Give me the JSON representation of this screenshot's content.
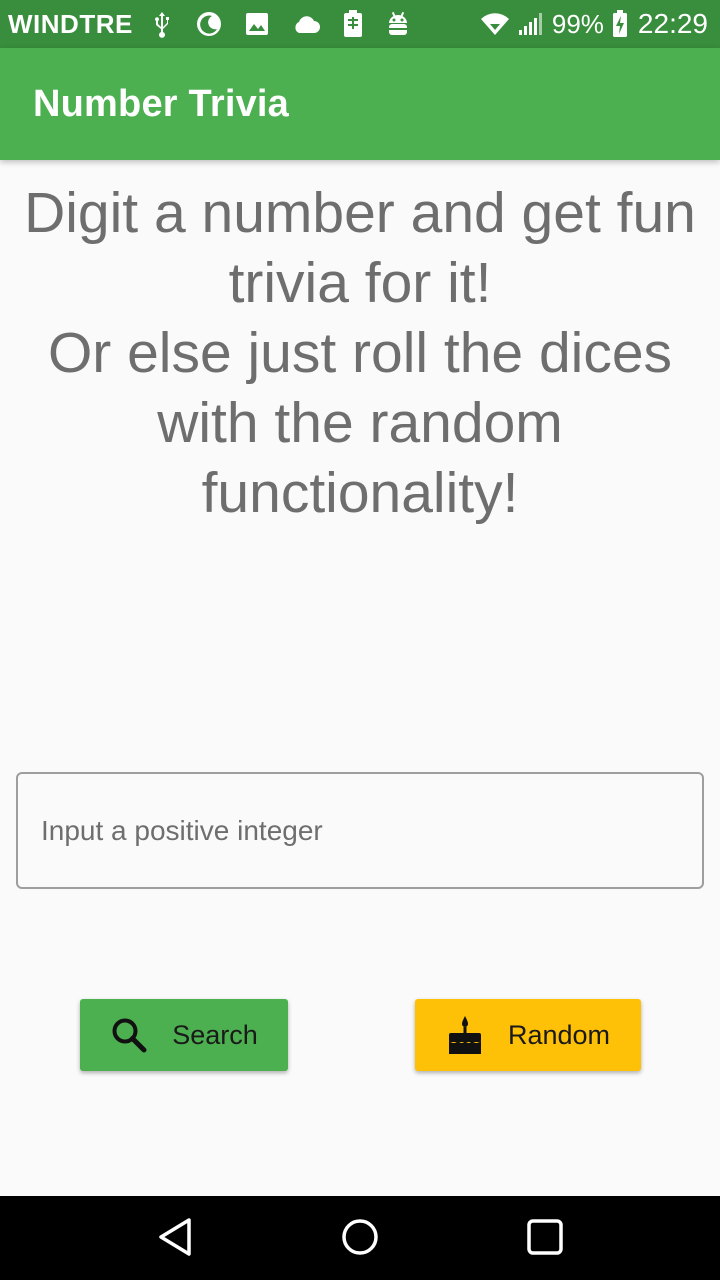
{
  "status_bar": {
    "carrier": "WINDTRE",
    "battery_percent": "99%",
    "time": "22:29",
    "icons_left": [
      "usb-icon",
      "do-not-disturb-icon",
      "image-icon",
      "cloud-icon",
      "sim-icon",
      "android-debug-icon"
    ],
    "icons_right": [
      "wifi-icon",
      "signal-icon",
      "battery-charging-icon"
    ]
  },
  "app_bar": {
    "title": "Number Trivia",
    "color": "#4caf50",
    "status_color": "#388e3c"
  },
  "main": {
    "intro_line1": "Digit a number and get fun trivia for it!",
    "intro_line2": "Or else just roll the dices with the random functionality!",
    "input": {
      "placeholder": "Input a positive integer",
      "value": ""
    },
    "search_button": {
      "label": "Search",
      "icon": "search-icon",
      "color": "#4caf50"
    },
    "random_button": {
      "label": "Random",
      "icon": "cake-icon",
      "color": "#ffc107"
    }
  },
  "nav_bar": {
    "buttons": [
      "back-icon",
      "home-icon",
      "recents-icon"
    ]
  }
}
